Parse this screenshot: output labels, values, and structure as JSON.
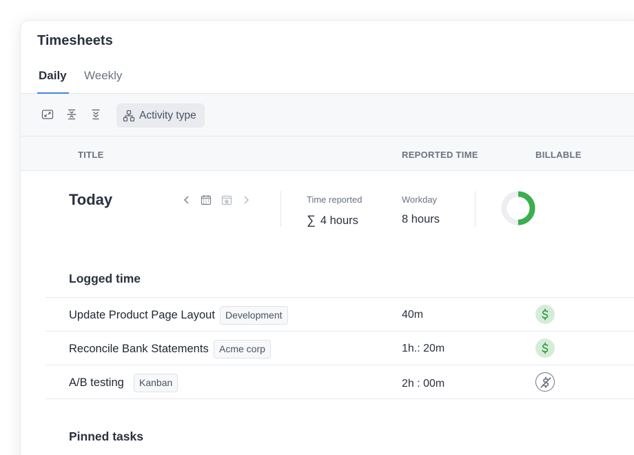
{
  "app": {
    "title": "Timesheets"
  },
  "tabs": [
    {
      "label": "Daily",
      "active": true
    },
    {
      "label": "Weekly",
      "active": false
    }
  ],
  "toolbar": {
    "icons": [
      "expand-icon",
      "collapse-rows-icon",
      "collapse-all-icon"
    ],
    "activity_label": "Activity type"
  },
  "columns": {
    "title": "TITLE",
    "reported_time": "REPORTED TIME",
    "billable": "BILLABLE"
  },
  "summary": {
    "heading": "Today",
    "time_reported_label": "Time reported",
    "time_reported_value": "4 hours",
    "workday_label": "Workday",
    "workday_value": "8 hours",
    "progress_fraction": 0.5,
    "colors": {
      "progress": "#3bae4f",
      "track": "#eceef1"
    }
  },
  "logged": {
    "title": "Logged time",
    "rows": [
      {
        "title": "Update Product Page Layout",
        "tag": "Development",
        "time": "40m",
        "billable": true
      },
      {
        "title": "Reconcile Bank Statements",
        "tag": "Acme corp",
        "time": "1h.: 20m",
        "billable": true
      },
      {
        "title": "A/B testing",
        "tag": "Kanban",
        "time": "2h : 00m",
        "billable": false
      }
    ]
  },
  "pinned": {
    "title": "Pinned tasks"
  },
  "colors": {
    "accent": "#3f83e6",
    "billable": "#2e9b45",
    "billable_bg": "#d6ecd9"
  }
}
